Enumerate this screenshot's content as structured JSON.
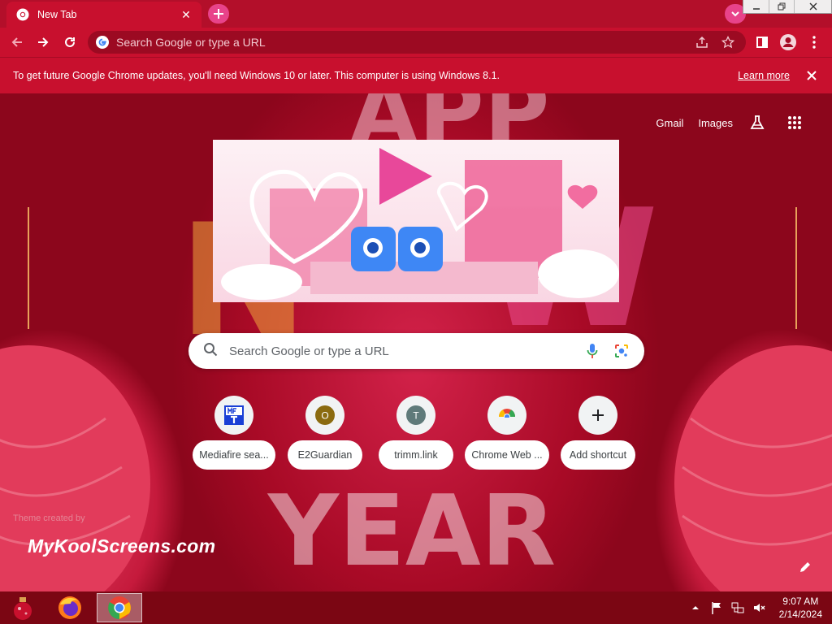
{
  "browser": {
    "tab": {
      "title": "New Tab",
      "favicon": "chrome-icon",
      "close_icon": "close-icon"
    },
    "new_tab_icon": "plus-icon",
    "tab_search_icon": "chevron-down-icon",
    "window_controls": {
      "minimize": "minimize-icon",
      "restore": "restore-icon",
      "close": "close-icon"
    },
    "toolbar": {
      "back_icon": "back-arrow-icon",
      "forward_icon": "forward-arrow-icon",
      "reload_icon": "reload-icon",
      "omnibox_placeholder": "Search Google or type a URL",
      "share_icon": "share-icon",
      "bookmark_icon": "star-icon",
      "side_panel_icon": "side-panel-icon",
      "profile_icon": "profile-icon",
      "menu_icon": "kebab-menu-icon"
    }
  },
  "infobar": {
    "message": "To get future Google Chrome updates, you'll need Windows 10 or later. This computer is using Windows 8.1.",
    "link": "Learn more",
    "close_icon": "close-icon"
  },
  "newtab": {
    "top_links": [
      "Gmail",
      "Images"
    ],
    "labs_icon": "flask-icon",
    "apps_icon": "apps-grid-icon",
    "search_placeholder": "Search Google or type a URL",
    "search_icon": "search-icon",
    "voice_icon": "microphone-icon",
    "lens_icon": "camera-lens-icon",
    "shortcuts": [
      {
        "label": "Mediafire sea...",
        "icon": "mediafire-icon"
      },
      {
        "label": "E2Guardian",
        "icon": "letter-o-icon",
        "letter": "O",
        "color": "#8b6b10"
      },
      {
        "label": "trimm.link",
        "icon": "letter-t-icon",
        "letter": "T",
        "color": "#5f7a7a"
      },
      {
        "label": "Chrome Web ...",
        "icon": "chrome-web-store-icon"
      },
      {
        "label": "Add shortcut",
        "icon": "plus-icon"
      }
    ],
    "theme_attribution": "Theme created by",
    "theme_brand": "MyKoolScreens.com",
    "customize_icon": "pencil-icon"
  },
  "taskbar": {
    "apps": [
      "start-ornament-icon",
      "firefox-icon",
      "chrome-icon"
    ],
    "tray_icons": [
      "chevron-up-icon",
      "flag-icon",
      "network-icon",
      "speaker-muted-icon"
    ],
    "time": "9:07 AM",
    "date": "2/14/2024"
  },
  "colors": {
    "theme_red": "#c8102e",
    "dark_red": "#9c0a22",
    "taskbar": "#7b0613"
  }
}
